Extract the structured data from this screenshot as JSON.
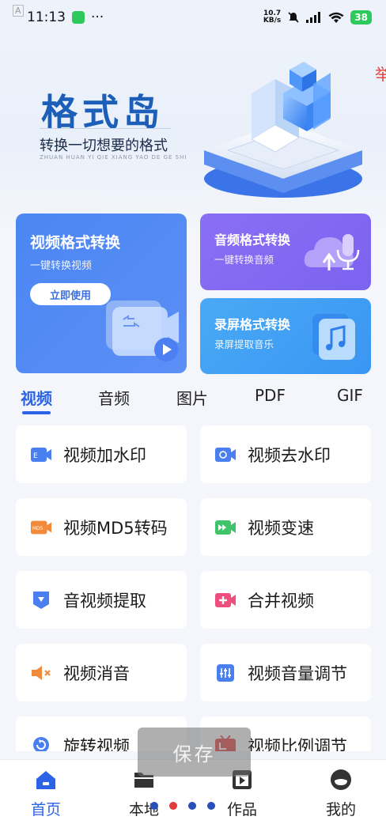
{
  "status_bar": {
    "time": "11:13",
    "more": "···",
    "net_speed_value": "10.7",
    "net_speed_unit": "KB/s",
    "battery": "38"
  },
  "banner": {
    "logo": "格式岛",
    "slogan": "转换一切想要的格式",
    "pinyin": "ZHUAN HUAN YI QIE XIANG YAO DE GE SHI",
    "edge_text": "举"
  },
  "cards": {
    "video": {
      "title": "视频格式转换",
      "subtitle": "一键转换视频",
      "button": "立即使用"
    },
    "audio": {
      "title": "音频格式转换",
      "subtitle": "一键转换音频"
    },
    "record": {
      "title": "录屏格式转换",
      "subtitle": "录屏提取音乐"
    }
  },
  "tabs": [
    "视频",
    "音频",
    "图片",
    "PDF",
    "GIF"
  ],
  "tools": [
    {
      "label": "视频加水印",
      "icon": "video-watermark-icon",
      "color": "#4a7ff0"
    },
    {
      "label": "视频去水印",
      "icon": "video-remove-watermark-icon",
      "color": "#4a7ff0"
    },
    {
      "label": "视频MD5转码",
      "icon": "md5-icon",
      "color": "#f28a3c"
    },
    {
      "label": "视频变速",
      "icon": "video-speed-icon",
      "color": "#3fc46a"
    },
    {
      "label": "音视频提取",
      "icon": "extract-icon",
      "color": "#4a7ff0"
    },
    {
      "label": "合并视频",
      "icon": "merge-video-icon",
      "color": "#ef4f7e"
    },
    {
      "label": "视频消音",
      "icon": "mute-icon",
      "color": "#f28a3c"
    },
    {
      "label": "视频音量调节",
      "icon": "volume-adjust-icon",
      "color": "#4a7ff0"
    },
    {
      "label": "旋转视频",
      "icon": "rotate-icon",
      "color": "#4a7ff0"
    },
    {
      "label": "视频比例调节",
      "icon": "ratio-adjust-icon",
      "color": "#e84848"
    }
  ],
  "toast": "保存",
  "nav": {
    "home": "首页",
    "local": "本地",
    "works": "作品",
    "mine": "我的"
  },
  "colors": {
    "primary": "#2b62e6",
    "video_card": "#4b86f3",
    "audio_card": "#8a6ff5",
    "record_card": "#4aa9f6"
  }
}
